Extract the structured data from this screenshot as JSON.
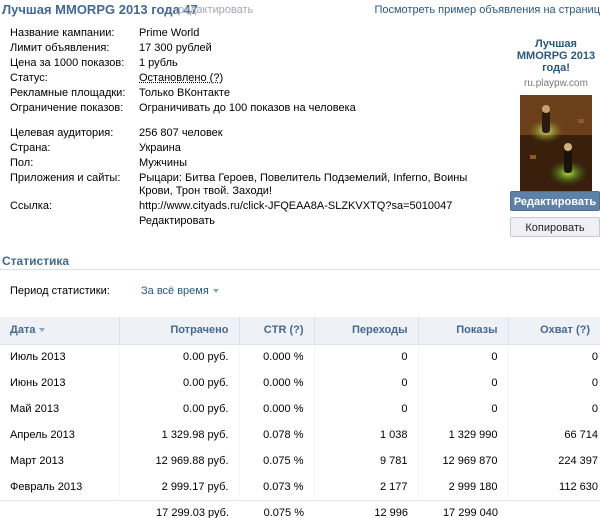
{
  "header": {
    "title": "Лучшая MMORPG 2013 года 47",
    "edit_label": "редактировать",
    "preview_link": "Посмотреть пример объявления на страниц"
  },
  "info": {
    "campaign_label": "Название кампании:",
    "campaign_value": "Prime World",
    "limit_label": "Лимит объявления:",
    "limit_value": "17 300 рублей",
    "price_label": "Цена за 1000 показов:",
    "price_value": "1 рубль",
    "status_label": "Статус:",
    "status_value": "Остановлено (?)",
    "placements_label": "Рекламные площадки:",
    "placements_value": "Только ВКонтакте",
    "impressions_label": "Ограничение показов:",
    "impressions_value": "Ограничивать до 100 показов на человека",
    "audience_label": "Целевая аудитория:",
    "audience_value": "256 807 человек",
    "country_label": "Страна:",
    "country_value": "Украина",
    "gender_label": "Пол:",
    "gender_value": "Мужчины",
    "apps_label": "Приложения и сайты:",
    "apps_value": "Рыцари: Битва Героев, Повелитель Подземелий, Inferno, Воины Крови, Трон твой. Заходи!",
    "link_label": "Ссылка:",
    "link_value": "http://www.cityads.ru/click-JFQEAA8A-SLZKVXTQ?sa=5010047",
    "link_edit": "Редактировать"
  },
  "ad": {
    "title": "Лучшая MMORPG 2013 года!",
    "domain": "ru.playpw.com"
  },
  "buttons": {
    "edit": "Редактировать",
    "copy": "Копировать"
  },
  "stats": {
    "title": "Статистика",
    "period_label": "Период статистики:",
    "period_value": "За всё время",
    "columns": [
      "Дата",
      "Потрачено",
      "CTR (?)",
      "Переходы",
      "Показы",
      "Охват (?)"
    ],
    "rows": [
      [
        "Июль 2013",
        "0.00 руб.",
        "0.000 %",
        "0",
        "0",
        "0"
      ],
      [
        "Июнь 2013",
        "0.00 руб.",
        "0.000 %",
        "0",
        "0",
        "0"
      ],
      [
        "Май 2013",
        "0.00 руб.",
        "0.000 %",
        "0",
        "0",
        "0"
      ],
      [
        "Апрель 2013",
        "1 329.98 руб.",
        "0.078 %",
        "1 038",
        "1 329 990",
        "66 714"
      ],
      [
        "Март 2013",
        "12 969.88 руб.",
        "0.075 %",
        "9 781",
        "12 969 870",
        "224 397"
      ],
      [
        "Февраль 2013",
        "2 999.17 руб.",
        "0.073 %",
        "2 177",
        "2 999 180",
        "112 630"
      ]
    ],
    "totals": [
      "",
      "17 299.03 руб.",
      "0.075 %",
      "12 996",
      "17 299 040",
      ""
    ]
  },
  "colors": {
    "accent": "#45688e",
    "link": "#2b587a",
    "button": "#5e81a8",
    "table_header": "#eef2f6"
  }
}
